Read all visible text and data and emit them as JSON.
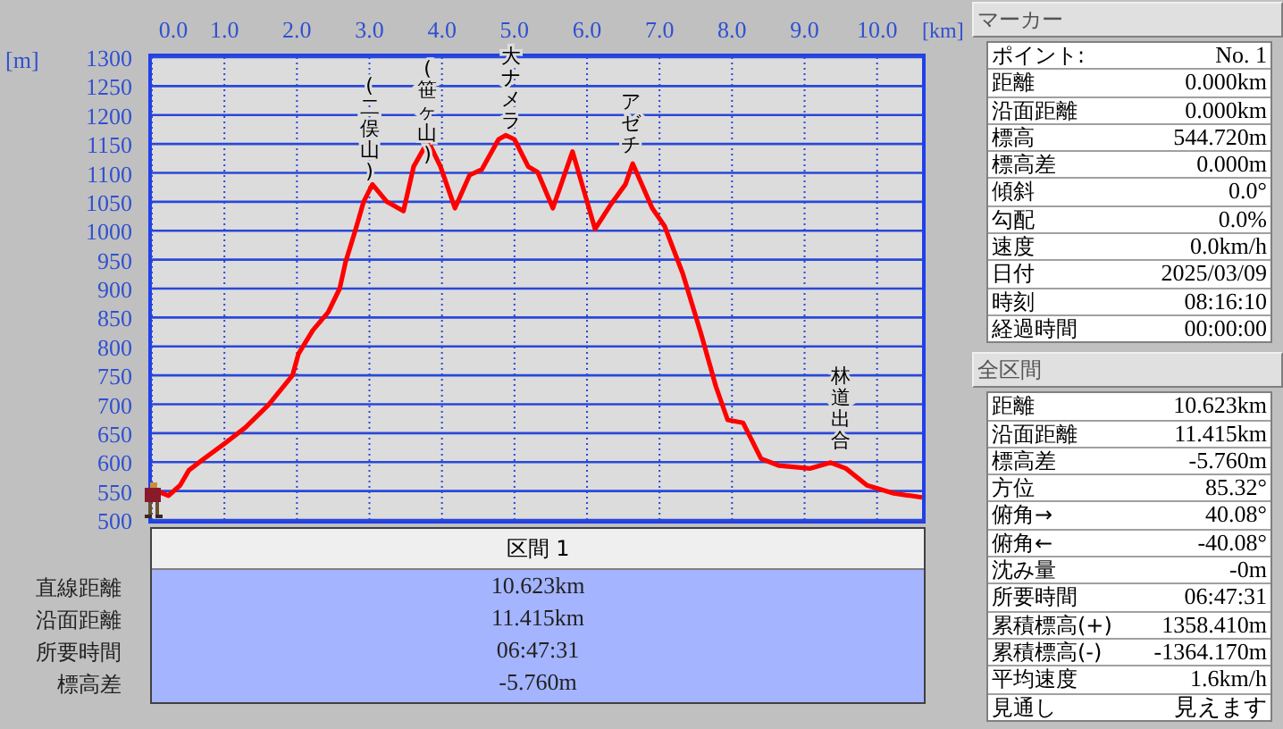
{
  "chart": {
    "y_unit": "[m]",
    "x_unit": "[km]",
    "chart_data": {
      "type": "line",
      "xlim": [
        0,
        10.62
      ],
      "ylim": [
        500,
        1300
      ],
      "xticks": [
        {
          "value": 0,
          "label": "0.0"
        },
        {
          "value": 1,
          "label": "1.0"
        },
        {
          "value": 2,
          "label": "2.0"
        },
        {
          "value": 3,
          "label": "3.0"
        },
        {
          "value": 4,
          "label": "4.0"
        },
        {
          "value": 5,
          "label": "5.0"
        },
        {
          "value": 6,
          "label": "6.0"
        },
        {
          "value": 7,
          "label": "7.0"
        },
        {
          "value": 8,
          "label": "8.0"
        },
        {
          "value": 9,
          "label": "9.0"
        },
        {
          "value": 10,
          "label": "10.0"
        }
      ],
      "yticks": [
        500,
        550,
        600,
        650,
        700,
        750,
        800,
        850,
        900,
        950,
        1000,
        1050,
        1100,
        1150,
        1200,
        1250,
        1300
      ],
      "x": [
        0.07,
        0.23,
        0.39,
        0.51,
        0.72,
        1.0,
        1.29,
        1.61,
        1.94,
        2.02,
        2.22,
        2.43,
        2.59,
        2.67,
        2.8,
        2.92,
        3.04,
        3.24,
        3.47,
        3.61,
        3.81,
        3.98,
        4.18,
        4.38,
        4.55,
        4.78,
        4.88,
        5.0,
        5.19,
        5.32,
        5.53,
        5.8,
        6.11,
        6.32,
        6.53,
        6.63,
        6.9,
        7.07,
        7.32,
        7.57,
        7.78,
        7.94,
        8.15,
        8.4,
        8.65,
        9.07,
        9.36,
        9.57,
        9.86,
        10.23,
        10.62
      ],
      "series": [
        {
          "color": "#ff0000",
          "values": [
            550,
            542,
            560,
            586,
            606,
            632,
            660,
            699,
            750,
            787,
            828,
            859,
            900,
            946,
            998,
            1050,
            1080,
            1050,
            1034,
            1111,
            1155,
            1111,
            1039,
            1096,
            1106,
            1158,
            1165,
            1158,
            1111,
            1101,
            1039,
            1137,
            1003,
            1044,
            1080,
            1116,
            1039,
            1008,
            926,
            823,
            730,
            673,
            668,
            606,
            594,
            589,
            599,
            589,
            560,
            546,
            539
          ]
        }
      ],
      "grid": true,
      "annotations": [
        "(二俣山)",
        "(笹ヶ山)",
        "大ナメラ",
        "アゼチ",
        "林道出合"
      ]
    }
  },
  "interval_table": {
    "header": "区間 1",
    "rows": [
      {
        "label": "直線距離",
        "value": "10.623km"
      },
      {
        "label": "沿面距離",
        "value": "11.415km"
      },
      {
        "label": "所要時間",
        "value": "06:47:31"
      },
      {
        "label": "標高差",
        "value": "-5.760m"
      }
    ]
  },
  "panels": [
    {
      "title": "マーカー",
      "rows": [
        {
          "label": "ポイント:",
          "value": "No. 1"
        },
        {
          "label": "距離",
          "value": "0.000km"
        },
        {
          "label": "沿面距離",
          "value": "0.000km"
        },
        {
          "label": "標高",
          "value": "544.720m"
        },
        {
          "label": "標高差",
          "value": "0.000m"
        },
        {
          "label": "傾斜",
          "value": "0.0°"
        },
        {
          "label": "勾配",
          "value": "0.0%"
        },
        {
          "label": "速度",
          "value": "0.0km/h"
        },
        {
          "label": "日付",
          "value": "2025/03/09"
        },
        {
          "label": "時刻",
          "value": "08:16:10"
        },
        {
          "label": "経過時間",
          "value": "00:00:00"
        }
      ]
    },
    {
      "title": "全区間",
      "rows": [
        {
          "label": "距離",
          "value": "10.623km"
        },
        {
          "label": "沿面距離",
          "value": "11.415km"
        },
        {
          "label": "標高差",
          "value": "-5.760m"
        },
        {
          "label": "方位",
          "value": "85.32°"
        },
        {
          "label": "俯角→",
          "value": "40.08°"
        },
        {
          "label": "俯角←",
          "value": "-40.08°"
        },
        {
          "label": "沈み量",
          "value": "-0m"
        },
        {
          "label": "所要時間",
          "value": "06:47:31"
        },
        {
          "label": "累積標高(+)",
          "value": "1358.410m"
        },
        {
          "label": "累積標高(-)",
          "value": "-1364.170m"
        },
        {
          "label": "平均速度",
          "value": "1.6km/h"
        },
        {
          "label": "見通し",
          "value": "見えます"
        }
      ]
    }
  ]
}
